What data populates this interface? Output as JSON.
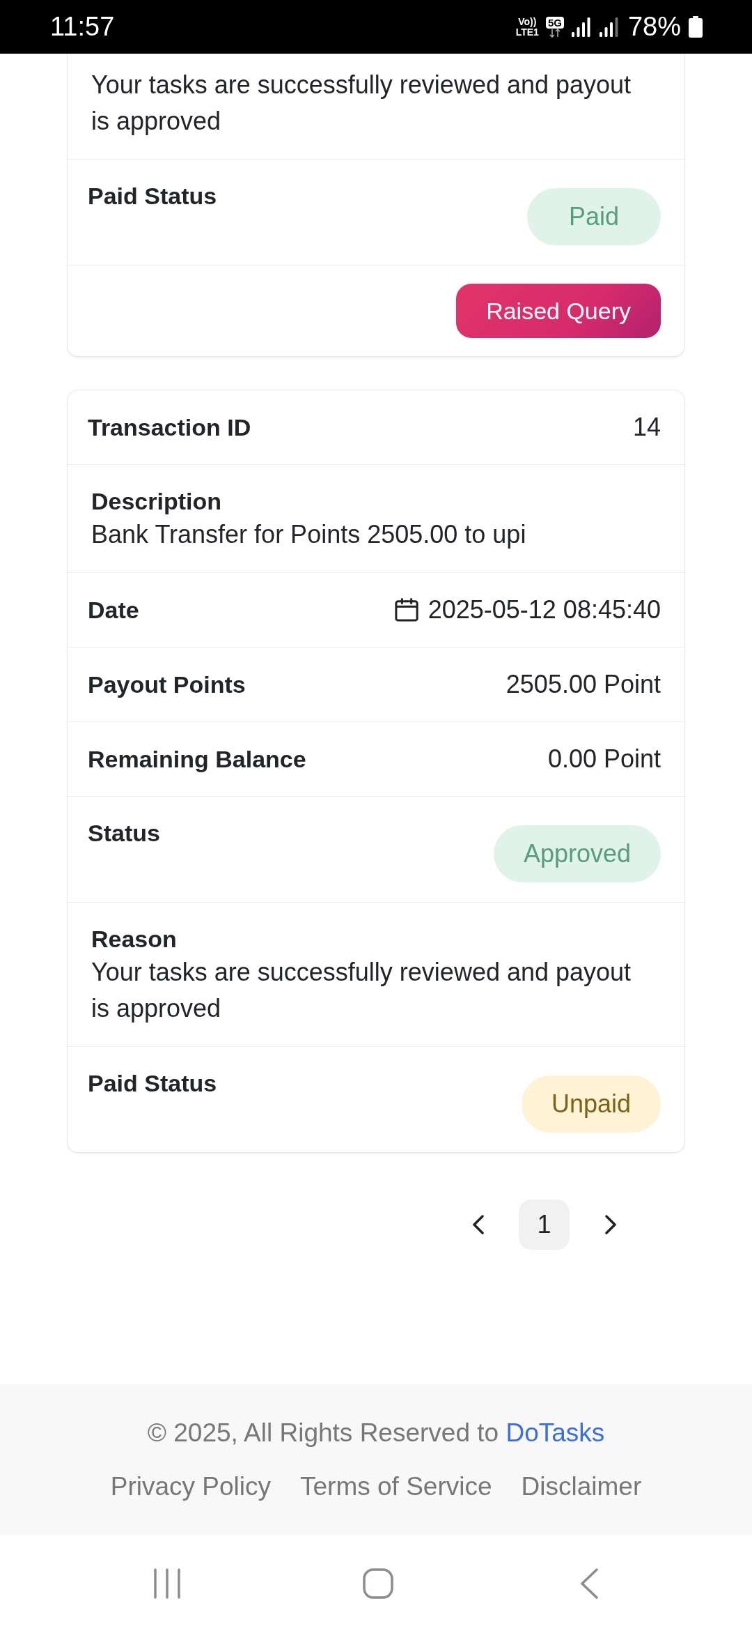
{
  "status_bar": {
    "time": "11:57",
    "volte": [
      "Vo))",
      "LTE1"
    ],
    "network": "5G",
    "battery": "78%"
  },
  "transactions": [
    {
      "fields": [
        {
          "kind": "block",
          "value": "Your tasks are successfully reviewed and payout is approved"
        },
        {
          "kind": "badge",
          "label": "Paid Status",
          "value": "Paid",
          "color": "#5a9d7c"
        }
      ],
      "action": "Raised Query"
    },
    {
      "fields": [
        {
          "kind": "pair",
          "label": "Transaction ID",
          "value": "14"
        },
        {
          "kind": "block",
          "label": "Description",
          "value": "Bank Transfer for Points 2505.00 to upi"
        },
        {
          "kind": "date",
          "label": "Date",
          "value": "2025-05-12 08:45:40"
        },
        {
          "kind": "pair",
          "label": "Payout Points",
          "value": "2505.00 Point"
        },
        {
          "kind": "pair",
          "label": "Remaining Balance",
          "value": "0.00 Point"
        },
        {
          "kind": "badge",
          "label": "Status",
          "value": "Approved",
          "color": "#5a9d7c"
        },
        {
          "kind": "block",
          "label": "Reason",
          "value": "Your tasks are successfully reviewed and payout is approved"
        },
        {
          "kind": "badge",
          "label": "Paid Status",
          "value": "Unpaid",
          "color": "#7b6318"
        }
      ]
    }
  ],
  "pagination": {
    "pages": [
      {
        "label": "1",
        "selected": true
      }
    ]
  },
  "footer": {
    "copyright": "© 2025, All Rights Reserved to",
    "brand": "DoTasks",
    "links": [
      "Privacy Policy",
      "Terms of Service",
      "Disclaimer"
    ]
  }
}
